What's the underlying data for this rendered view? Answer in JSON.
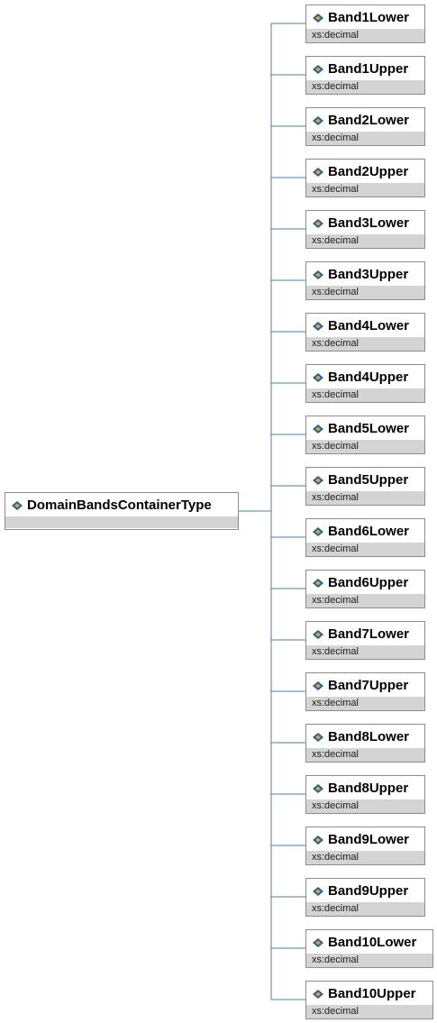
{
  "root": {
    "label": "DomainBandsContainerType",
    "icon": "element-diamond-icon"
  },
  "children": [
    {
      "label": "Band1Lower",
      "type": "xs:decimal",
      "icon": "element-diamond-icon"
    },
    {
      "label": "Band1Upper",
      "type": "xs:decimal",
      "icon": "element-diamond-icon"
    },
    {
      "label": "Band2Lower",
      "type": "xs:decimal",
      "icon": "element-diamond-icon"
    },
    {
      "label": "Band2Upper",
      "type": "xs:decimal",
      "icon": "element-diamond-icon"
    },
    {
      "label": "Band3Lower",
      "type": "xs:decimal",
      "icon": "element-diamond-icon"
    },
    {
      "label": "Band3Upper",
      "type": "xs:decimal",
      "icon": "element-diamond-icon"
    },
    {
      "label": "Band4Lower",
      "type": "xs:decimal",
      "icon": "element-diamond-icon"
    },
    {
      "label": "Band4Upper",
      "type": "xs:decimal",
      "icon": "element-diamond-icon"
    },
    {
      "label": "Band5Lower",
      "type": "xs:decimal",
      "icon": "element-diamond-icon"
    },
    {
      "label": "Band5Upper",
      "type": "xs:decimal",
      "icon": "element-diamond-icon"
    },
    {
      "label": "Band6Lower",
      "type": "xs:decimal",
      "icon": "element-diamond-icon"
    },
    {
      "label": "Band6Upper",
      "type": "xs:decimal",
      "icon": "element-diamond-icon"
    },
    {
      "label": "Band7Lower",
      "type": "xs:decimal",
      "icon": "element-diamond-icon"
    },
    {
      "label": "Band7Upper",
      "type": "xs:decimal",
      "icon": "element-diamond-icon"
    },
    {
      "label": "Band8Lower",
      "type": "xs:decimal",
      "icon": "element-diamond-icon"
    },
    {
      "label": "Band8Upper",
      "type": "xs:decimal",
      "icon": "element-diamond-icon"
    },
    {
      "label": "Band9Lower",
      "type": "xs:decimal",
      "icon": "element-diamond-icon"
    },
    {
      "label": "Band9Upper",
      "type": "xs:decimal",
      "icon": "element-diamond-icon"
    },
    {
      "label": "Band10Lower",
      "type": "xs:decimal",
      "icon": "element-diamond-icon"
    },
    {
      "label": "Band10Upper",
      "type": "xs:decimal",
      "icon": "element-diamond-icon"
    }
  ],
  "colors": {
    "connector": "#4a7fa5",
    "border": "#8c8c8c",
    "type_bar": "#d4d4d4",
    "icon_blue": "#1f5fa8",
    "icon_gold": "#e6a817"
  }
}
